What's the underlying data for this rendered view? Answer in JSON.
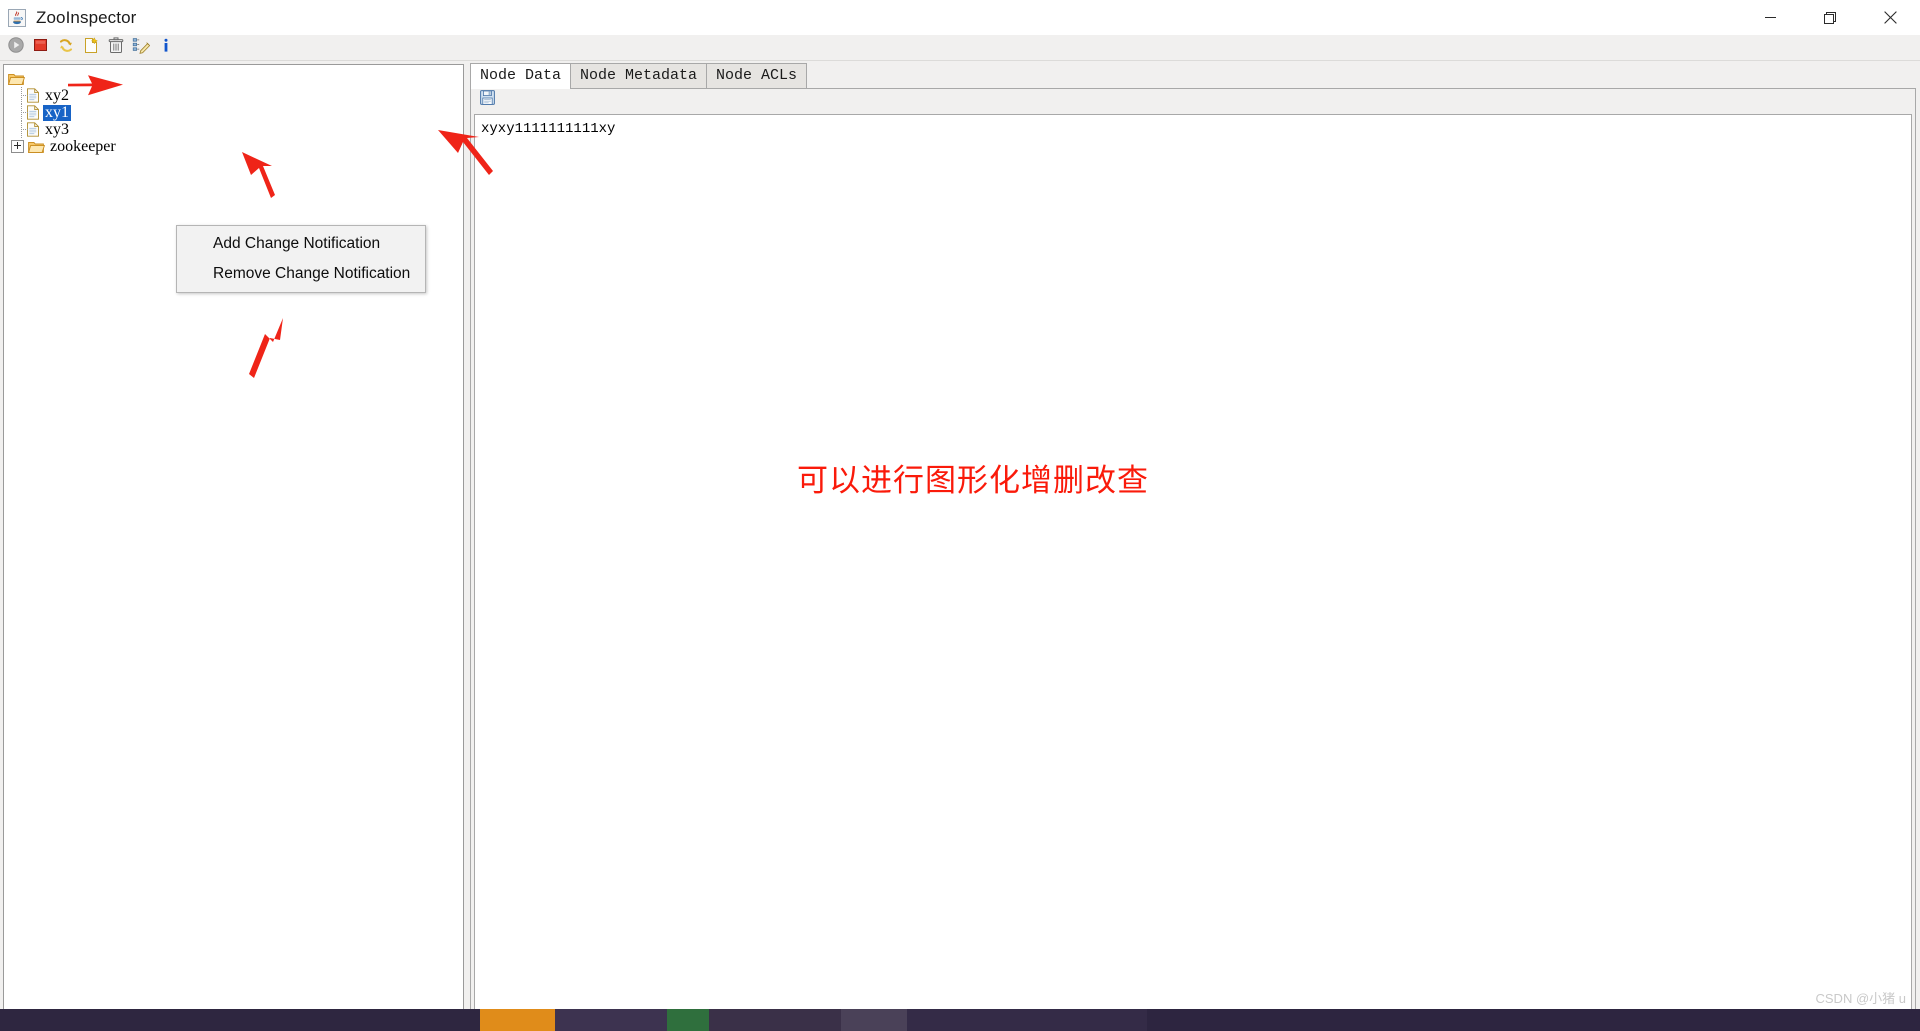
{
  "window": {
    "title": "ZooInspector",
    "app_icon": "java-coffee-cup-icon",
    "minimize_label": "Minimize",
    "maximize_label": "Maximize",
    "close_label": "Close"
  },
  "toolbar": {
    "buttons": [
      {
        "name": "connect-button",
        "icon": "play-circle-icon",
        "label": "Connect",
        "enabled": false
      },
      {
        "name": "disconnect-button",
        "icon": "stop-square-icon",
        "label": "Disconnect",
        "enabled": true
      },
      {
        "name": "refresh-button",
        "icon": "refresh-arrows-icon",
        "label": "Refresh",
        "enabled": true
      },
      {
        "name": "add-node-button",
        "icon": "new-document-icon",
        "label": "Add Node",
        "enabled": true
      },
      {
        "name": "delete-node-button",
        "icon": "trash-can-icon",
        "label": "Delete Node",
        "enabled": true
      },
      {
        "name": "edit-node-button",
        "icon": "edit-tree-pencil-icon",
        "label": "Edit Node",
        "enabled": true
      },
      {
        "name": "about-button",
        "icon": "info-i-icon",
        "label": "About",
        "enabled": true
      }
    ]
  },
  "tree": {
    "root_icon": "open-folder-icon",
    "nodes": [
      {
        "label": "xy2",
        "icon": "document-icon",
        "selected": false,
        "expandable": false
      },
      {
        "label": "xy1",
        "icon": "document-icon",
        "selected": true,
        "expandable": false
      },
      {
        "label": "xy3",
        "icon": "document-icon",
        "selected": false,
        "expandable": false
      },
      {
        "label": "zookeeper",
        "icon": "closed-folder-icon",
        "selected": false,
        "expandable": true
      }
    ],
    "selection_color": "#1763c6"
  },
  "tabs": [
    {
      "label": "Node Data",
      "active": true
    },
    {
      "label": "Node Metadata",
      "active": false
    },
    {
      "label": "Node ACLs",
      "active": false
    }
  ],
  "node_data": {
    "save_icon": "floppy-disk-save-icon",
    "save_label": "Save",
    "content": "xyxy1111111111xy"
  },
  "context_menu": {
    "items": [
      {
        "label": "Add Change Notification"
      },
      {
        "label": "Remove Change Notification"
      }
    ]
  },
  "annotations": {
    "note_text": "可以进行图形化增删改查",
    "note_color": "#fa1a0a",
    "arrow_color": "#ef2418",
    "arrows": [
      {
        "name": "arrow-to-selected-node"
      },
      {
        "name": "arrow-to-node-data-text"
      },
      {
        "name": "arrow-to-context-menu-top"
      },
      {
        "name": "arrow-to-context-menu-bottom"
      }
    ]
  },
  "watermark": {
    "text": "CSDN @小猪 u"
  }
}
